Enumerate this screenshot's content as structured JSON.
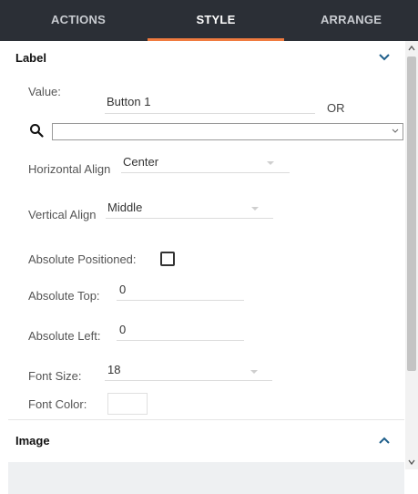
{
  "tabs": [
    {
      "label": "ACTIONS",
      "active": false
    },
    {
      "label": "STYLE",
      "active": true
    },
    {
      "label": "ARRANGE",
      "active": false
    }
  ],
  "accent_color": "#f07b3f",
  "sections": {
    "label": {
      "title": "Label",
      "expanded": true,
      "icon": "chevron-down-icon"
    },
    "image": {
      "title": "Image",
      "expanded": false,
      "icon": "chevron-up-icon"
    }
  },
  "fields": {
    "value": {
      "label": "Value:",
      "value": "Button 1",
      "or_text": "OR"
    },
    "search": {
      "icon": "search-icon",
      "value": ""
    },
    "horizontal_align": {
      "label": "Horizontal Align",
      "value": "Center"
    },
    "vertical_align": {
      "label": "Vertical Align",
      "value": "Middle"
    },
    "absolute_positioned": {
      "label": "Absolute Positioned:",
      "checked": false
    },
    "absolute_top": {
      "label": "Absolute Top:",
      "value": "0"
    },
    "absolute_left": {
      "label": "Absolute Left:",
      "value": "0"
    },
    "font_size": {
      "label": "Font Size:",
      "value": "18"
    },
    "font_color": {
      "label": "Font Color:",
      "value": "#ffffff"
    }
  }
}
